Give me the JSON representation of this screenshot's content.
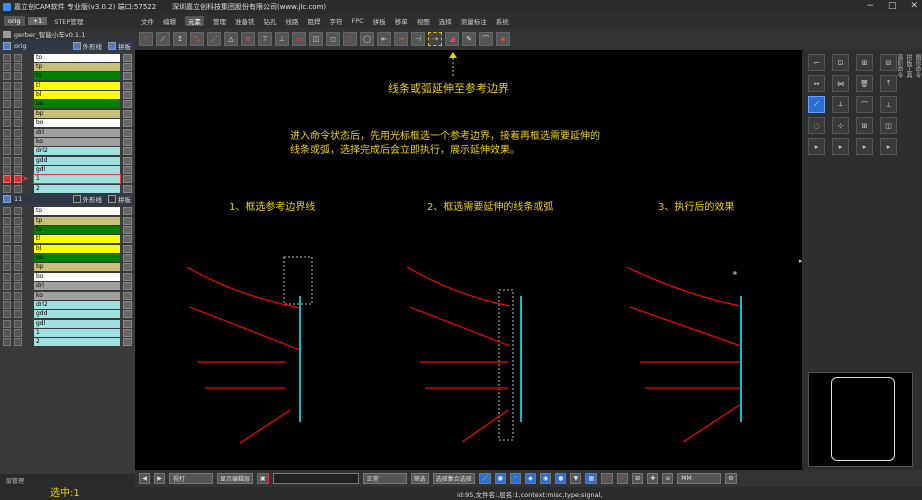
{
  "window": {
    "title": "嘉立创CAM软件 专业版(v3.0.2) 端口:57522",
    "company": "深圳嘉立创科技集团股份有限公司(www.jlc.com)"
  },
  "left": {
    "tabs": [
      "orig",
      "+1",
      "STEP管理"
    ],
    "job": "gerber_智能小车v0.1.1",
    "groups": [
      {
        "name": "orig",
        "opt1": "外形线",
        "opt2": "拼板",
        "layers": [
          {
            "name": "to",
            "color": "#ffffff"
          },
          {
            "name": "tp",
            "color": "#c8c078"
          },
          {
            "name": "ts",
            "color": "#008000"
          },
          {
            "name": "tl",
            "color": "#ffff00"
          },
          {
            "name": "bl",
            "color": "#ffff00"
          },
          {
            "name": "bs",
            "color": "#008000"
          },
          {
            "name": "bp",
            "color": "#c8c078"
          },
          {
            "name": "bo",
            "color": "#ffffff"
          },
          {
            "name": "drl",
            "color": "#a0a0a0"
          },
          {
            "name": "ko",
            "color": "#a0a0a0"
          },
          {
            "name": "drl2",
            "color": "#a0e0e0"
          },
          {
            "name": "gdd",
            "color": "#a0e0e0"
          },
          {
            "name": "gdl",
            "color": "#a0e0e0"
          },
          {
            "name": "1",
            "color": "#a0e0e0",
            "selected": true
          },
          {
            "name": "2",
            "color": "#a0e0e0"
          }
        ]
      },
      {
        "name": "11",
        "opt1": "外形线",
        "opt2": "拼板",
        "layers": [
          {
            "name": "to",
            "color": "#ffffff"
          },
          {
            "name": "tp",
            "color": "#c8c078"
          },
          {
            "name": "ts",
            "color": "#008000"
          },
          {
            "name": "tl",
            "color": "#ffff00"
          },
          {
            "name": "bl",
            "color": "#ffff00"
          },
          {
            "name": "bs",
            "color": "#008000"
          },
          {
            "name": "bp",
            "color": "#c8c078"
          },
          {
            "name": "bo",
            "color": "#ffffff"
          },
          {
            "name": "drl",
            "color": "#a0a0a0"
          },
          {
            "name": "ko",
            "color": "#a0a0a0"
          },
          {
            "name": "drl2",
            "color": "#a0e0e0"
          },
          {
            "name": "gdd",
            "color": "#a0e0e0"
          },
          {
            "name": "gdl",
            "color": "#a0e0e0"
          },
          {
            "name": "1",
            "color": "#a0e0e0"
          },
          {
            "name": "2",
            "color": "#a0e0e0"
          }
        ]
      }
    ],
    "footer_manager": "层管理",
    "selected_count": "选中:1"
  },
  "menu": [
    "文件",
    "编辑",
    "元素",
    "管理",
    "准备铣",
    "钻孔",
    "线路",
    "阻焊",
    "字符",
    "FPC",
    "拼板",
    "移单",
    "视图",
    "选择",
    "测量标注",
    "系统"
  ],
  "menu_active": "元素",
  "canvas": {
    "heading": "线条或弧延伸至参考边界",
    "desc_line1": "进入命令状态后，先用光标框选一个参考边界，接着再框选需要延伸的",
    "desc_line2": "线条或弧，选择完成后会立即执行，展示延伸效果。",
    "step1": "1、框选参考边界线",
    "step2": "2、框选需要延伸的线条或弧",
    "step3": "3、执行后的效果"
  },
  "right_panel": {
    "side_tabs": [
      "图形命令",
      "拼板工具",
      "高阶命令"
    ]
  },
  "bottom": {
    "zoom_mode": "视打",
    "display_btn": "显示编辑层",
    "normal_dd": "正常",
    "filter_btn": "筛选",
    "select_all_btn": "选择集合选择",
    "unit": "MM",
    "status": "id:95,文件名:,层名:1,context:misc,type:signal,"
  },
  "colors": {
    "annotation": "#f0d000",
    "line_red": "#ff0000",
    "boundary_cyan": "#00c0d0"
  }
}
